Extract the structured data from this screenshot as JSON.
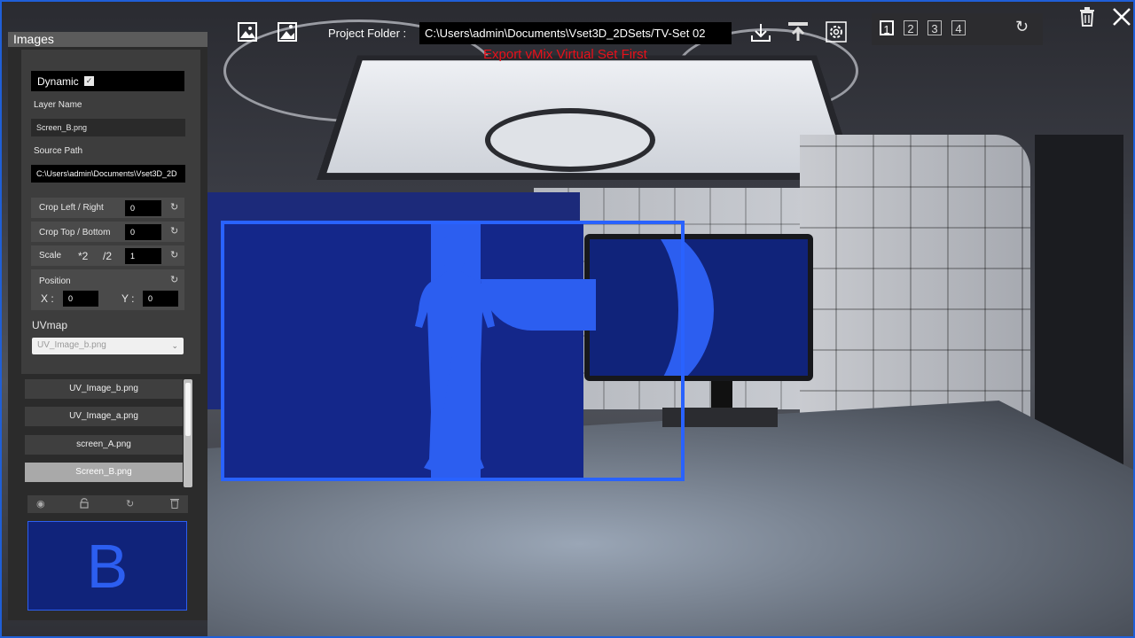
{
  "topbar": {
    "project_folder_label": "Project Folder :",
    "project_folder_path": "C:\\Users\\admin\\Documents\\Vset3D_2DSets/TV-Set 02",
    "export_warning": "Export vMix Virtual Set First",
    "layouts": [
      "1",
      "2",
      "3",
      "4"
    ],
    "active_layout": "1"
  },
  "panel": {
    "title": "Images",
    "dynamic_label": "Dynamic",
    "dynamic_checked": "✓",
    "layer_name_label": "Layer Name",
    "layer_name_value": "Screen_B.png",
    "source_path_label": "Source Path",
    "source_path_value": "C:\\Users\\admin\\Documents\\Vset3D_2D",
    "crop_lr_label": "Crop Left / Right",
    "crop_lr_value": "0",
    "crop_tb_label": "Crop Top / Bottom",
    "crop_tb_value": "0",
    "scale_label": "Scale",
    "scale_x2": "*2",
    "scale_div2": "/2",
    "scale_value": "1",
    "position_label": "Position",
    "pos_x_label": "X :",
    "pos_x_value": "0",
    "pos_y_label": "Y :",
    "pos_y_value": "0",
    "uvmap_label": "UVmap",
    "uvmap_selected": "UV_Image_b.png",
    "images": [
      "UV_Image_b.png",
      "UV_Image_a.png",
      "screen_A.png",
      "Screen_B.png"
    ],
    "selected_image": "Screen_B.png",
    "preview_letter": "B"
  },
  "colors": {
    "accent_blue": "#2962ff",
    "screen_blue": "#10237a",
    "warning_red": "#e8101a"
  },
  "icons": {
    "top_left": [
      "add-image-icon",
      "add-image-alt-icon"
    ],
    "top_right": [
      "download-icon",
      "upload-icon",
      "settings-icon",
      "refresh-icon",
      "trash-icon",
      "close-icon"
    ],
    "panel_toolbar": [
      "eye-icon",
      "lock-icon",
      "refresh-icon",
      "trash-icon"
    ]
  }
}
